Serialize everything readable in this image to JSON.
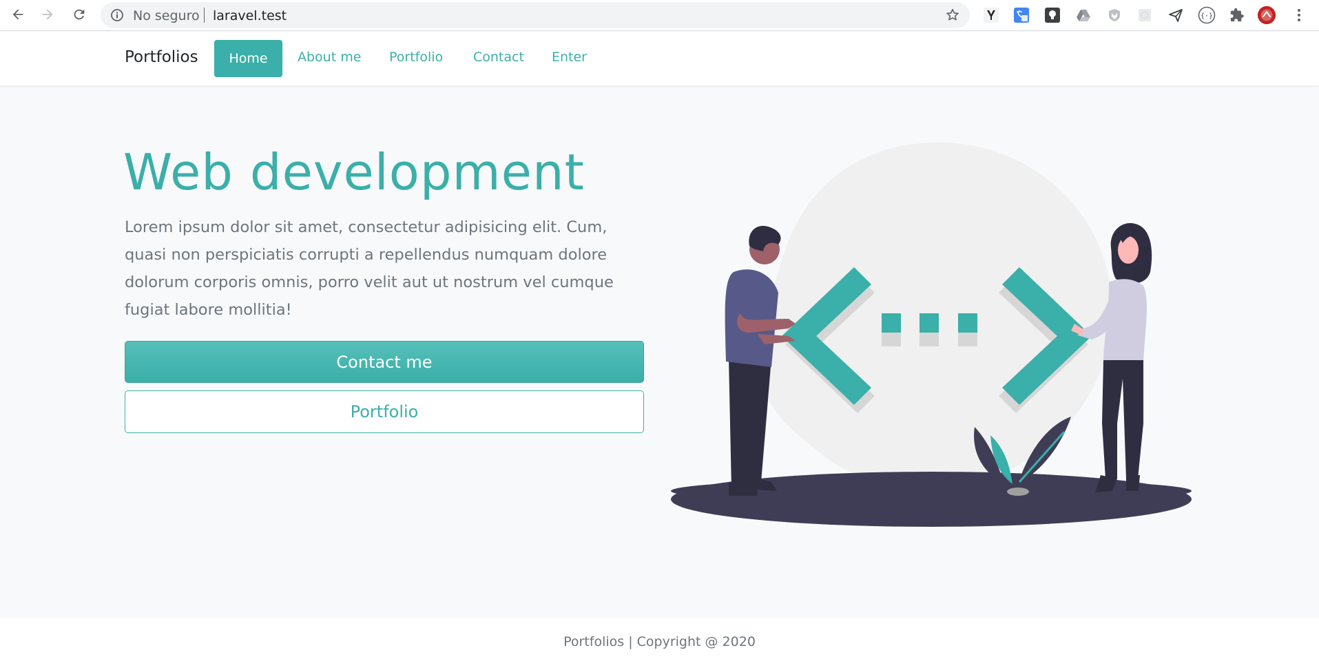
{
  "browser": {
    "security_label": "No seguro",
    "url": "laravel.test",
    "icons": [
      "back-icon",
      "forward-icon",
      "reload-icon",
      "info-icon",
      "star-icon",
      "extensions"
    ]
  },
  "navbar": {
    "brand": "Portfolios",
    "items": [
      {
        "label": "Home",
        "active": true
      },
      {
        "label": "About me"
      },
      {
        "label": "Portfolio"
      },
      {
        "label": "Contact"
      },
      {
        "label": "Enter"
      }
    ]
  },
  "hero": {
    "title": "Web development",
    "text": "Lorem ipsum dolor sit amet, consectetur adipisicing elit. Cum, quasi non perspiciatis corrupti a repellendus numquam dolore dolorum corporis omnis, porro velit aut ut nostrum vel cumque fugiat labore mollitia!",
    "contact_button": "Contact me",
    "portfolio_button": "Portfolio"
  },
  "footer": {
    "text": "Portfolios | Copyright @ 2020"
  },
  "colors": {
    "accent": "#3bafa9",
    "body_bg": "#f8f9fa",
    "text": "#6c757d",
    "dark": "#3f3d56"
  }
}
